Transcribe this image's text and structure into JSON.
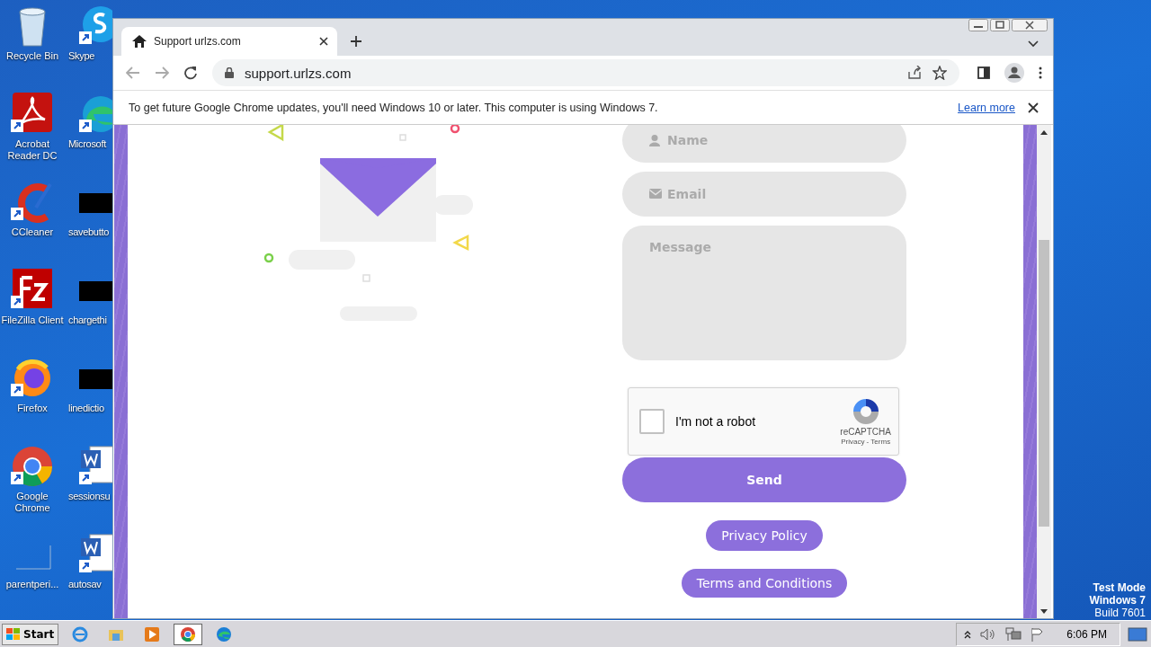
{
  "desktop": {
    "icon_columns": [
      {
        "icons": [
          {
            "label": "Recycle Bin",
            "kind": "recycle"
          },
          {
            "label": "Acrobat Reader DC",
            "kind": "pdf"
          },
          {
            "label": "CCleaner",
            "kind": "cleaner"
          },
          {
            "label": "FileZilla Client",
            "kind": "ftp"
          },
          {
            "label": "Firefox",
            "kind": "firefox"
          },
          {
            "label": "Google Chrome",
            "kind": "chrome"
          },
          {
            "label": "parentperi...",
            "kind": "blank"
          }
        ]
      },
      {
        "icons": [
          {
            "label": "Skype",
            "kind": "skype"
          },
          {
            "label": "Microsoft",
            "kind": "edge"
          },
          {
            "label": "savebutto",
            "kind": "dark"
          },
          {
            "label": "chargethi",
            "kind": "dark"
          },
          {
            "label": "linedictio",
            "kind": "dark"
          },
          {
            "label": "sessionsu",
            "kind": "word"
          },
          {
            "label": "autosav",
            "kind": "word"
          }
        ]
      }
    ],
    "test_mode": [
      "Test Mode",
      "Windows 7",
      "Build 7601"
    ]
  },
  "browser": {
    "tabs": [
      {
        "title": "Support urlzs.com",
        "selected": true
      }
    ],
    "address": "support.urlzs.com",
    "infobar": {
      "message": "To get future Google Chrome updates, you'll need Windows 10 or later. This computer is using Windows 7.",
      "link": "Learn more"
    },
    "form": {
      "fields": [
        {
          "kind": "name",
          "placeholder": "Name"
        },
        {
          "kind": "email",
          "placeholder": "Email"
        },
        {
          "kind": "message",
          "placeholder": "Message"
        }
      ],
      "captcha": {
        "label": "I'm not a robot",
        "checked": false,
        "brand": "reCAPTCHA",
        "links": "Privacy - Terms"
      },
      "submit": "Send",
      "links": [
        "Privacy Policy",
        "Terms and Conditions"
      ]
    }
  },
  "taskbar": {
    "start": "Start",
    "apps": [
      {
        "kind": "ie",
        "selected": false
      },
      {
        "kind": "folder",
        "selected": false
      },
      {
        "kind": "media",
        "selected": false
      },
      {
        "kind": "chrome",
        "selected": true
      },
      {
        "kind": "edge",
        "selected": false
      }
    ],
    "clock": "6:06 PM"
  }
}
